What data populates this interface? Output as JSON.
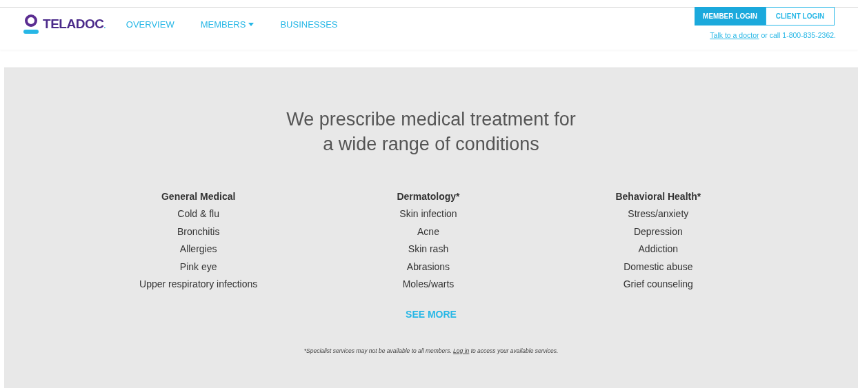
{
  "header": {
    "logo": "TELADOC",
    "logo_mark": ".",
    "nav": [
      {
        "label": "OVERVIEW",
        "dropdown": false
      },
      {
        "label": "MEMBERS",
        "dropdown": true
      },
      {
        "label": "BUSINESSES",
        "dropdown": false
      }
    ],
    "login_tabs": [
      {
        "label": "MEMBER LOGIN",
        "selected": true
      },
      {
        "label": "CLIENT LOGIN",
        "selected": false
      }
    ],
    "contact": {
      "link": "Talk to a doctor",
      "text": " or call 1-800-835-2362."
    }
  },
  "main": {
    "heading_lines": [
      "We prescribe medical treatment for",
      "a wide range of conditions"
    ],
    "columns": [
      {
        "title": "General Medical",
        "items": [
          "Cold & flu",
          "Bronchitis",
          "Allergies",
          "Pink eye",
          "Upper respiratory infections"
        ]
      },
      {
        "title": "Dermatology*",
        "items": [
          "Skin infection",
          "Acne",
          "Skin rash",
          "Abrasions",
          "Moles/warts"
        ]
      },
      {
        "title": "Behavioral Health*",
        "items": [
          "Stress/anxiety",
          "Depression",
          "Addiction",
          "Domestic abuse",
          "Grief counseling"
        ]
      }
    ],
    "see_more": "SEE MORE",
    "footnote": {
      "before": "*Specialist services may not be available to all members. ",
      "link": "Log in",
      "after": " to access your available services."
    }
  }
}
